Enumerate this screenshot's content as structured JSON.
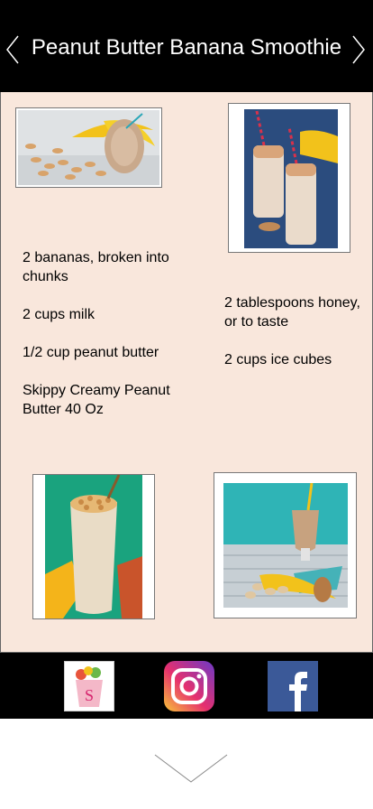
{
  "header": {
    "title": "Peanut Butter Banana Smoothie",
    "prev_icon": "chevron-left-icon",
    "next_icon": "chevron-right-icon"
  },
  "ingredients_left": [
    "2 bananas, broken into chunks",
    "2 cups milk",
    "1/2 cup peanut butter",
    "Skippy Creamy Peanut Butter 40 Oz"
  ],
  "ingredients_right": [
    "2 tablespoons honey, or to taste",
    "2 cups ice cubes"
  ],
  "footer": {
    "links": [
      "smoothie-app-icon",
      "instagram-icon",
      "facebook-icon"
    ]
  },
  "colors": {
    "header_bg": "#000000",
    "content_bg": "#f9e7dc",
    "instagram": "#d6246e",
    "facebook": "#3b5998"
  }
}
